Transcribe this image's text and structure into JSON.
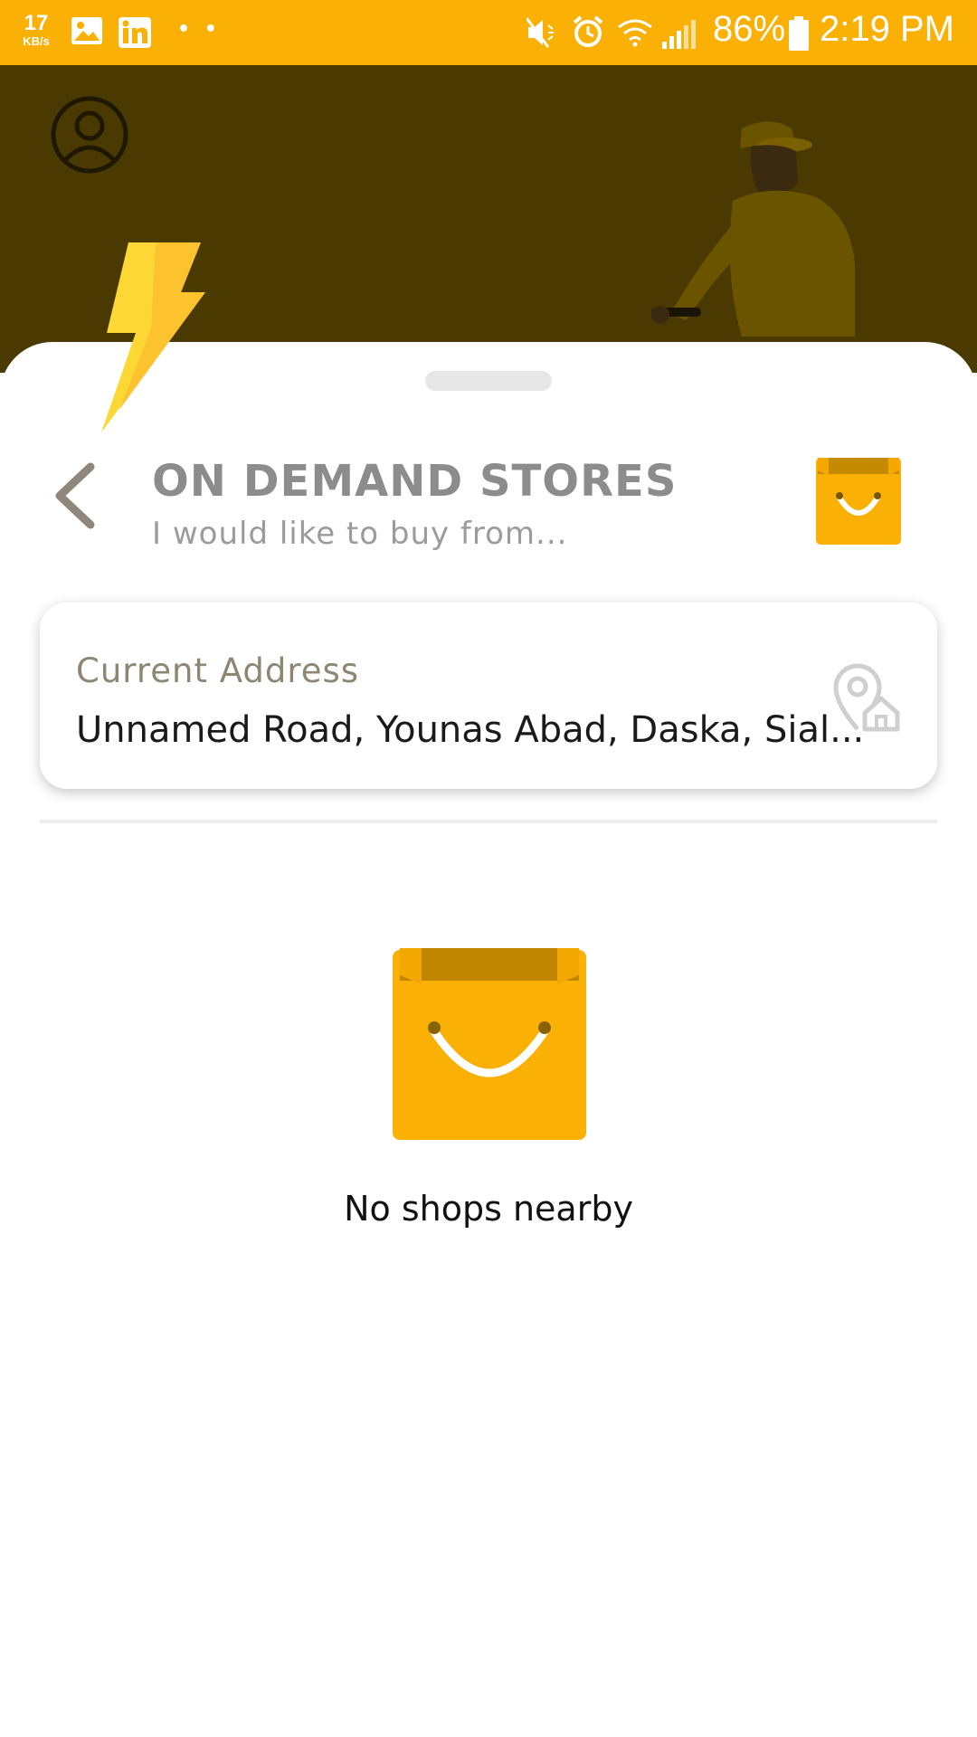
{
  "status_bar": {
    "net_speed_value": "17",
    "net_speed_unit": "KB/s",
    "notification_icons": [
      "image-icon",
      "linkedin-icon",
      "more-dots"
    ],
    "more_dots": "• •",
    "system_icons": [
      "mute-icon",
      "alarm-icon",
      "wifi-icon",
      "signal-icon"
    ],
    "battery": "86%",
    "time": "2:19 PM"
  },
  "hero": {
    "icons": [
      "profile-icon",
      "delivery-rider-illustration",
      "lightning-bolt-icon"
    ]
  },
  "header": {
    "title": "ON DEMAND STORES",
    "subtitle": "I would like to buy from..."
  },
  "address": {
    "label": "Current Address",
    "value": "Unnamed Road, Younas Abad, Daska, Sial..."
  },
  "empty_state": {
    "message": "No shops nearby"
  },
  "colors": {
    "accent": "#FAB005",
    "hero_background": "#4A3A02",
    "title": "#8c8c8c"
  }
}
